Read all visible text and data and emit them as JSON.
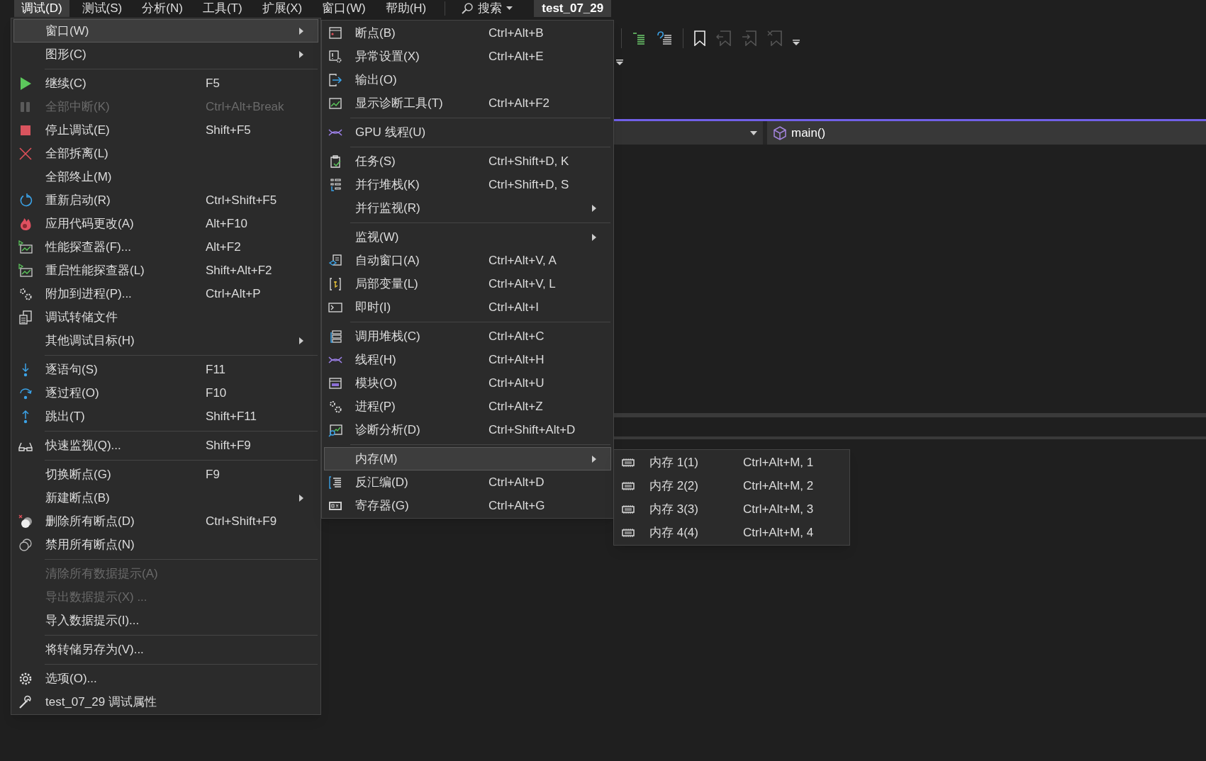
{
  "menu_bar": {
    "items": [
      {
        "label": "调试(D)",
        "selected": true
      },
      {
        "label": "测试(S)",
        "selected": false
      },
      {
        "label": "分析(N)",
        "selected": false
      },
      {
        "label": "工具(T)",
        "selected": false
      },
      {
        "label": "扩展(X)",
        "selected": false
      },
      {
        "label": "窗口(W)",
        "selected": false
      },
      {
        "label": "帮助(H)",
        "selected": false
      }
    ],
    "search": {
      "label": "搜索"
    },
    "project_tab": "test_07_29"
  },
  "navigation_bar": {
    "member": "main()"
  },
  "debug_menu": {
    "groups": [
      [
        {
          "label": "窗口(W)",
          "disabled": false,
          "submenu": true,
          "selected": true
        },
        {
          "label": "图形(C)",
          "disabled": false,
          "submenu": true,
          "selected": false
        }
      ],
      [
        {
          "label": "继续(C)",
          "shortcut": "F5",
          "disabled": false,
          "submenu": false,
          "selected": false
        },
        {
          "label": "全部中断(K)",
          "shortcut": "Ctrl+Alt+Break",
          "disabled": true,
          "submenu": false,
          "selected": false
        },
        {
          "label": "停止调试(E)",
          "shortcut": "Shift+F5",
          "disabled": false,
          "submenu": false,
          "selected": false
        },
        {
          "label": "全部拆离(L)",
          "disabled": false,
          "submenu": false,
          "selected": false
        },
        {
          "label": "全部终止(M)",
          "disabled": false,
          "submenu": false,
          "selected": false
        },
        {
          "label": "重新启动(R)",
          "shortcut": "Ctrl+Shift+F5",
          "disabled": false,
          "submenu": false,
          "selected": false
        },
        {
          "label": "应用代码更改(A)",
          "shortcut": "Alt+F10",
          "disabled": false,
          "submenu": false,
          "selected": false
        },
        {
          "label": "性能探查器(F)...",
          "shortcut": "Alt+F2",
          "disabled": false,
          "submenu": false,
          "selected": false
        },
        {
          "label": "重启性能探查器(L)",
          "shortcut": "Shift+Alt+F2",
          "disabled": false,
          "submenu": false,
          "selected": false
        },
        {
          "label": "附加到进程(P)...",
          "shortcut": "Ctrl+Alt+P",
          "disabled": false,
          "submenu": false,
          "selected": false
        },
        {
          "label": "调试转储文件",
          "disabled": false,
          "submenu": false,
          "selected": false
        },
        {
          "label": "其他调试目标(H)",
          "disabled": false,
          "submenu": true,
          "selected": false
        }
      ],
      [
        {
          "label": "逐语句(S)",
          "shortcut": "F11",
          "disabled": false,
          "submenu": false,
          "selected": false
        },
        {
          "label": "逐过程(O)",
          "shortcut": "F10",
          "disabled": false,
          "submenu": false,
          "selected": false
        },
        {
          "label": "跳出(T)",
          "shortcut": "Shift+F11",
          "disabled": false,
          "submenu": false,
          "selected": false
        }
      ],
      [
        {
          "label": "快速监视(Q)...",
          "shortcut": "Shift+F9",
          "disabled": false,
          "submenu": false,
          "selected": false
        }
      ],
      [
        {
          "label": "切换断点(G)",
          "shortcut": "F9",
          "disabled": false,
          "submenu": false,
          "selected": false
        },
        {
          "label": "新建断点(B)",
          "disabled": false,
          "submenu": true,
          "selected": false
        },
        {
          "label": "删除所有断点(D)",
          "shortcut": "Ctrl+Shift+F9",
          "disabled": false,
          "submenu": false,
          "selected": false
        },
        {
          "label": "禁用所有断点(N)",
          "disabled": false,
          "submenu": false,
          "selected": false
        }
      ],
      [
        {
          "label": "清除所有数据提示(A)",
          "disabled": true,
          "submenu": false,
          "selected": false
        },
        {
          "label": "导出数据提示(X) ...",
          "disabled": true,
          "submenu": false,
          "selected": false
        },
        {
          "label": "导入数据提示(I)...",
          "disabled": false,
          "submenu": false,
          "selected": false
        }
      ],
      [
        {
          "label": "将转储另存为(V)...",
          "disabled": false,
          "submenu": false,
          "selected": false
        }
      ],
      [
        {
          "label": "选项(O)...",
          "disabled": false,
          "submenu": false,
          "selected": false
        },
        {
          "label": "test_07_29 调试属性",
          "disabled": false,
          "submenu": false,
          "selected": false
        }
      ]
    ]
  },
  "window_submenu": {
    "groups": [
      [
        {
          "label": "断点(B)",
          "shortcut": "Ctrl+Alt+B",
          "submenu": false,
          "selected": false
        },
        {
          "label": "异常设置(X)",
          "shortcut": "Ctrl+Alt+E",
          "submenu": false,
          "selected": false
        },
        {
          "label": "输出(O)",
          "submenu": false,
          "selected": false
        },
        {
          "label": "显示诊断工具(T)",
          "shortcut": "Ctrl+Alt+F2",
          "submenu": false,
          "selected": false
        }
      ],
      [
        {
          "label": "GPU 线程(U)",
          "submenu": false,
          "selected": false
        }
      ],
      [
        {
          "label": "任务(S)",
          "shortcut": "Ctrl+Shift+D, K",
          "submenu": false,
          "selected": false
        },
        {
          "label": "并行堆栈(K)",
          "shortcut": "Ctrl+Shift+D, S",
          "submenu": false,
          "selected": false
        },
        {
          "label": "并行监视(R)",
          "submenu": true,
          "selected": false
        }
      ],
      [
        {
          "label": "监视(W)",
          "submenu": true,
          "selected": false
        },
        {
          "label": "自动窗口(A)",
          "shortcut": "Ctrl+Alt+V, A",
          "submenu": false,
          "selected": false
        },
        {
          "label": "局部变量(L)",
          "shortcut": "Ctrl+Alt+V, L",
          "submenu": false,
          "selected": false
        },
        {
          "label": "即时(I)",
          "shortcut": "Ctrl+Alt+I",
          "submenu": false,
          "selected": false
        }
      ],
      [
        {
          "label": "调用堆栈(C)",
          "shortcut": "Ctrl+Alt+C",
          "submenu": false,
          "selected": false
        },
        {
          "label": "线程(H)",
          "shortcut": "Ctrl+Alt+H",
          "submenu": false,
          "selected": false
        },
        {
          "label": "模块(O)",
          "shortcut": "Ctrl+Alt+U",
          "submenu": false,
          "selected": false
        },
        {
          "label": "进程(P)",
          "shortcut": "Ctrl+Alt+Z",
          "submenu": false,
          "selected": false
        },
        {
          "label": "诊断分析(D)",
          "shortcut": "Ctrl+Shift+Alt+D",
          "submenu": false,
          "selected": false
        }
      ],
      [
        {
          "label": "内存(M)",
          "submenu": true,
          "selected": true
        },
        {
          "label": "反汇编(D)",
          "shortcut": "Ctrl+Alt+D",
          "submenu": false,
          "selected": false
        },
        {
          "label": "寄存器(G)",
          "shortcut": "Ctrl+Alt+G",
          "submenu": false,
          "selected": false
        }
      ]
    ]
  },
  "memory_submenu": {
    "groups": [
      [
        {
          "label": "内存 1(1)",
          "shortcut": "Ctrl+Alt+M, 1",
          "submenu": false,
          "selected": false
        },
        {
          "label": "内存 2(2)",
          "shortcut": "Ctrl+Alt+M, 2",
          "submenu": false,
          "selected": false
        },
        {
          "label": "内存 3(3)",
          "shortcut": "Ctrl+Alt+M, 3",
          "submenu": false,
          "selected": false
        },
        {
          "label": "内存 4(4)",
          "shortcut": "Ctrl+Alt+M, 4",
          "submenu": false,
          "selected": false
        }
      ]
    ]
  }
}
